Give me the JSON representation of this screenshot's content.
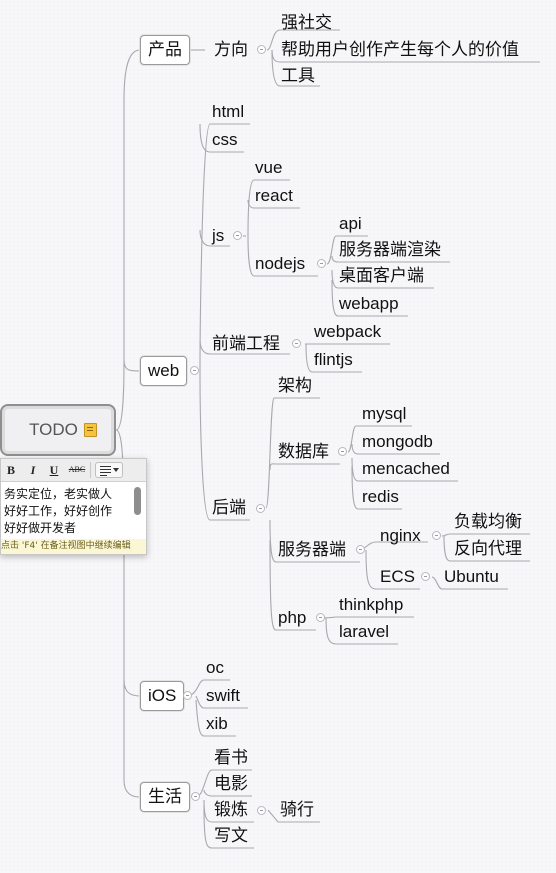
{
  "root": {
    "label": "TODO",
    "note_icon": "note-icon"
  },
  "note": {
    "toolbar": {
      "bold": "B",
      "italic": "I",
      "underline": "U",
      "strike": "ABC",
      "align": "align-icon"
    },
    "text": "务实定位，老实做人\n好好工作，好好创作\n好好做开发者",
    "hint": "点击 'F4' 在备注视图中继续编辑"
  },
  "branches": {
    "product": {
      "label": "产品",
      "fangxiang": {
        "label": "方向",
        "items": [
          "强社交",
          "帮助用户创作产生每个人的价值",
          "工具"
        ]
      }
    },
    "web": {
      "label": "web",
      "html": "html",
      "css": "css",
      "js": {
        "label": "js",
        "vue": "vue",
        "react": "react",
        "nodejs": {
          "label": "nodejs",
          "items": [
            "api",
            "服务器端渲染",
            "桌面客户端",
            "webapp"
          ]
        }
      },
      "frontend_eng": {
        "label": "前端工程",
        "items": [
          "webpack",
          "flintjs"
        ]
      },
      "backend": {
        "label": "后端",
        "arch": "架构",
        "db": {
          "label": "数据库",
          "items": [
            "mysql",
            "mongodb",
            "mencached",
            "redis"
          ]
        },
        "server": {
          "label": "服务器端",
          "nginx": {
            "label": "nginx",
            "items": [
              "负载均衡",
              "反向代理"
            ]
          },
          "ecs": {
            "label": "ECS",
            "items": [
              "Ubuntu"
            ]
          }
        },
        "php": {
          "label": "php",
          "items": [
            "thinkphp",
            "laravel"
          ]
        }
      }
    },
    "ios": {
      "label": "iOS",
      "items": [
        "oc",
        "swift",
        "xib"
      ]
    },
    "life": {
      "label": "生活",
      "book": "看书",
      "movie": "电影",
      "exercise": {
        "label": "锻炼",
        "items": [
          "骑行"
        ]
      },
      "write": "写文"
    }
  }
}
